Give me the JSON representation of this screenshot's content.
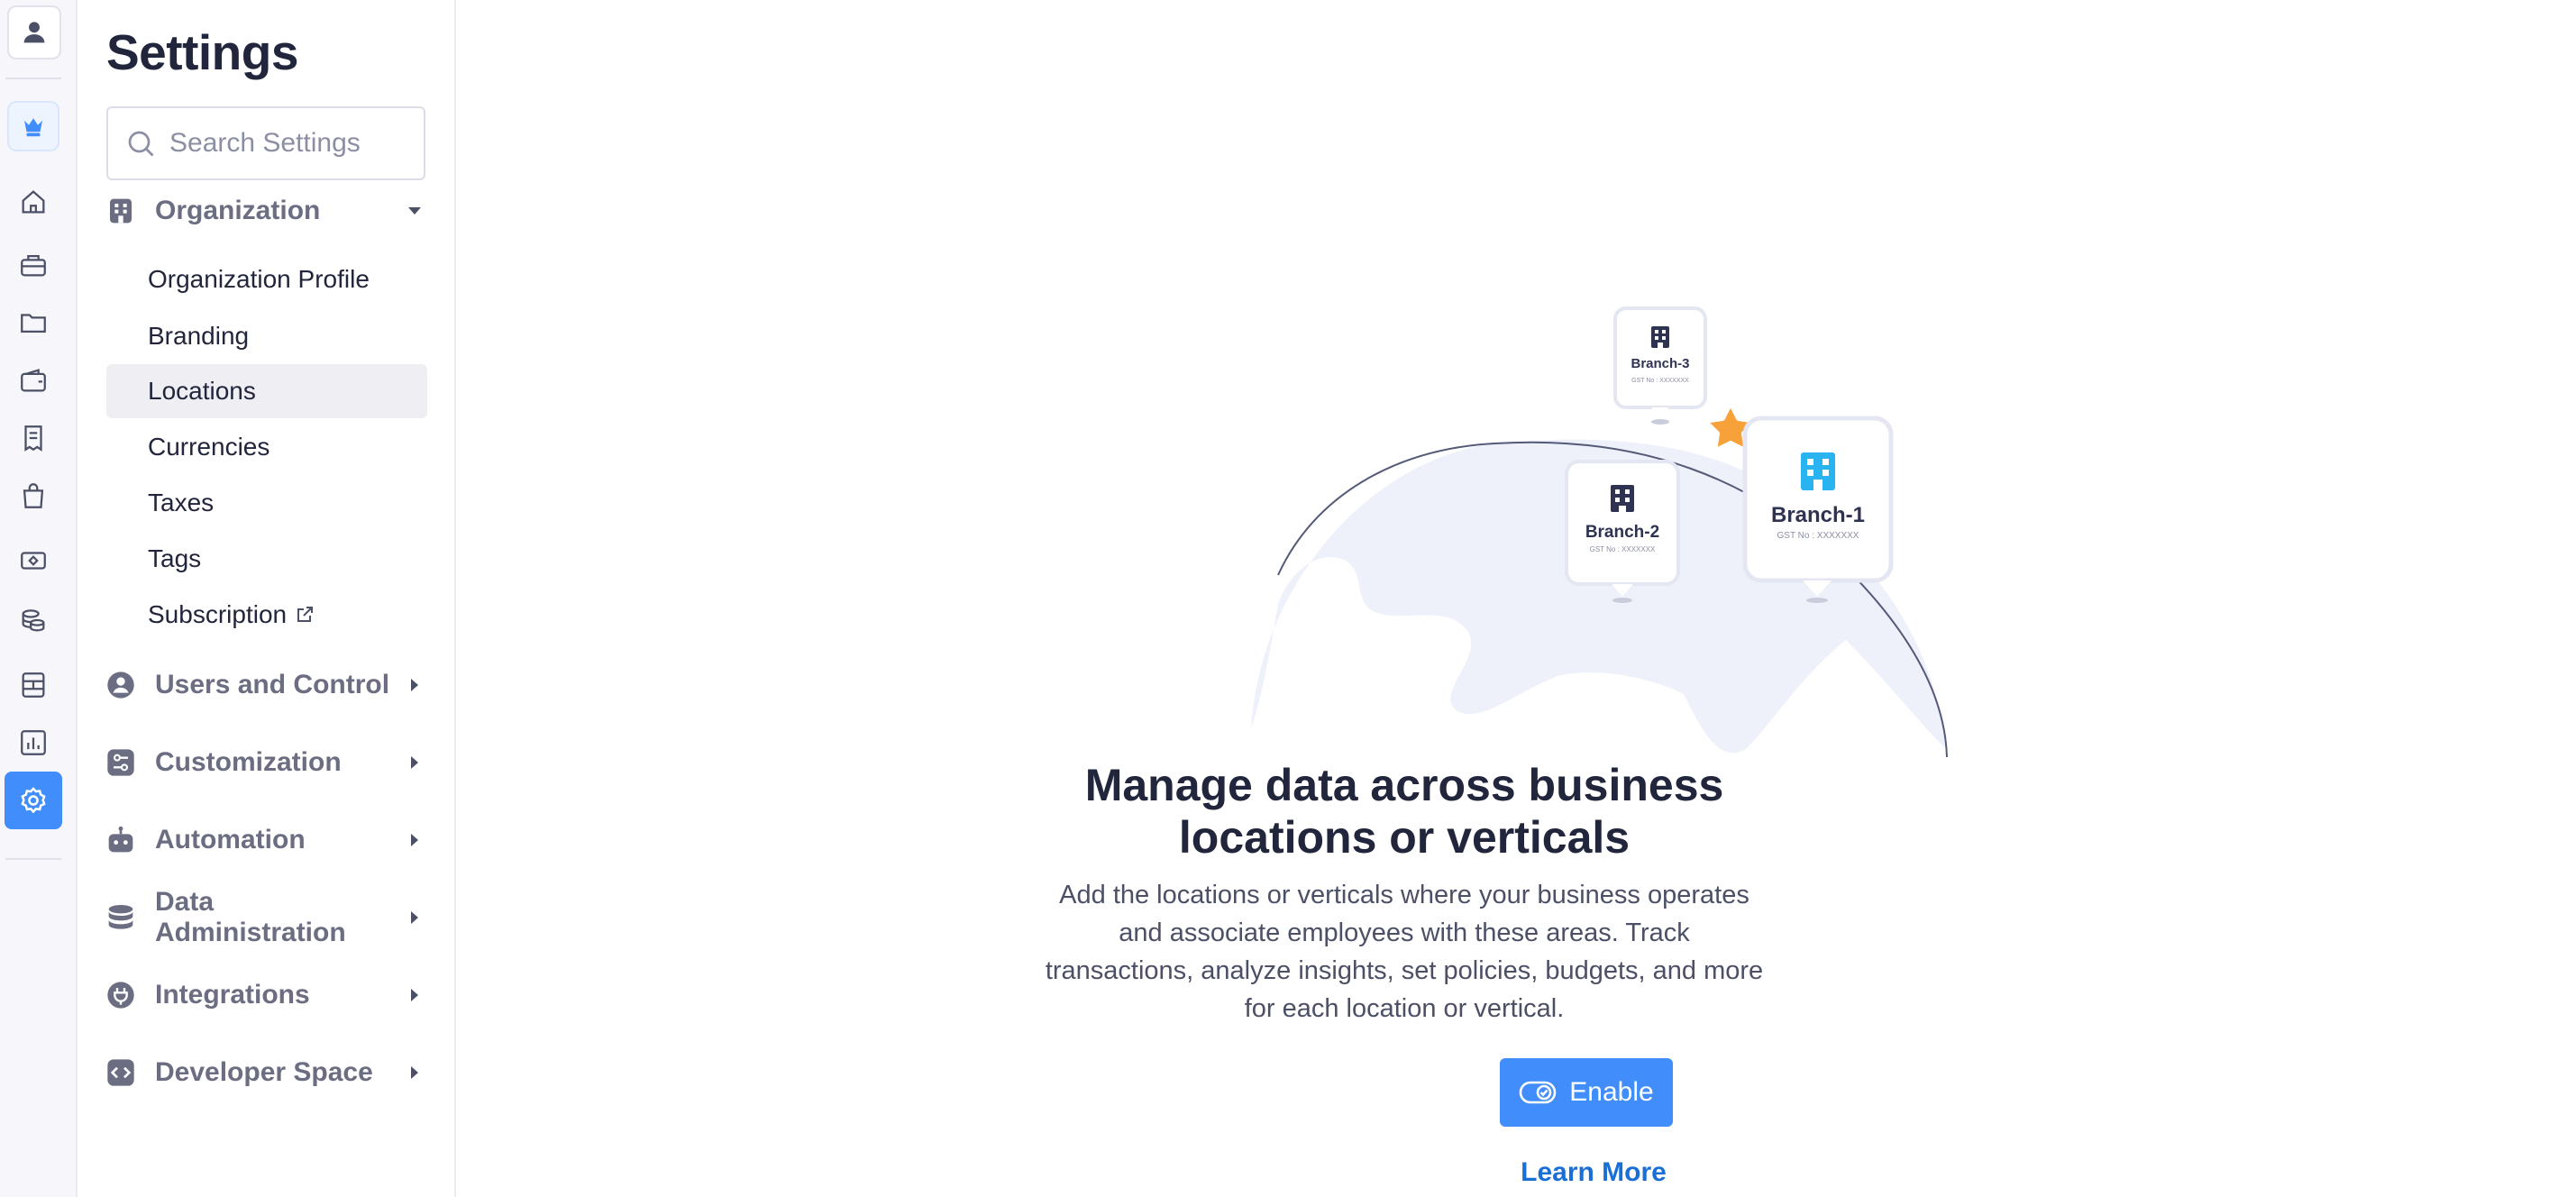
{
  "rail": {
    "items": [
      {
        "name": "home-icon"
      },
      {
        "name": "briefcase-icon"
      },
      {
        "name": "folder-icon"
      },
      {
        "name": "wallet-icon"
      },
      {
        "name": "receipt-icon"
      },
      {
        "name": "shopping-bag-icon"
      },
      {
        "name": "cash-icon"
      },
      {
        "name": "coins-icon"
      },
      {
        "name": "ledger-icon"
      },
      {
        "name": "reports-icon"
      },
      {
        "name": "settings-icon",
        "active": true
      }
    ],
    "active_color": "#408dfb"
  },
  "sidebar": {
    "title": "Settings",
    "search": {
      "placeholder": "Search Settings",
      "value": ""
    },
    "groups": [
      {
        "label": "Organization",
        "icon": "building-icon",
        "expanded": true
      },
      {
        "label": "Users and Control",
        "icon": "user-circle-icon"
      },
      {
        "label": "Customization",
        "icon": "sliders-icon"
      },
      {
        "label": "Automation",
        "icon": "robot-icon"
      },
      {
        "label": "Data Administration",
        "icon": "database-icon"
      },
      {
        "label": "Integrations",
        "icon": "plug-icon"
      },
      {
        "label": "Developer Space",
        "icon": "code-icon"
      }
    ],
    "organization_items": [
      {
        "label": "Organization Profile"
      },
      {
        "label": "Branding"
      },
      {
        "label": "Locations",
        "active": true
      },
      {
        "label": "Currencies"
      },
      {
        "label": "Taxes"
      },
      {
        "label": "Tags"
      },
      {
        "label": "Subscription",
        "external": true
      }
    ]
  },
  "main": {
    "illustration": {
      "branches": [
        {
          "name": "Branch-1",
          "gst": "GST No : XXXXXXX"
        },
        {
          "name": "Branch-2",
          "gst": "GST No : XXXXXXX"
        },
        {
          "name": "Branch-3",
          "gst": "GST No : XXXXXXX"
        }
      ]
    },
    "headline": "Manage data across business locations or verticals",
    "description": "Add the locations or verticals where your business operates and associate employees with these areas. Track transactions, analyze insights, set policies, budgets, and more for each location or vertical.",
    "enable_label": "Enable",
    "learn_more_label": "Learn More"
  },
  "colors": {
    "accent": "#408dfb",
    "link": "#1a6fd6",
    "globe": "#eef0fa",
    "star": "#f6a13a",
    "branch1_icon": "#29b3f0",
    "branch_icon": "#2e3352"
  }
}
